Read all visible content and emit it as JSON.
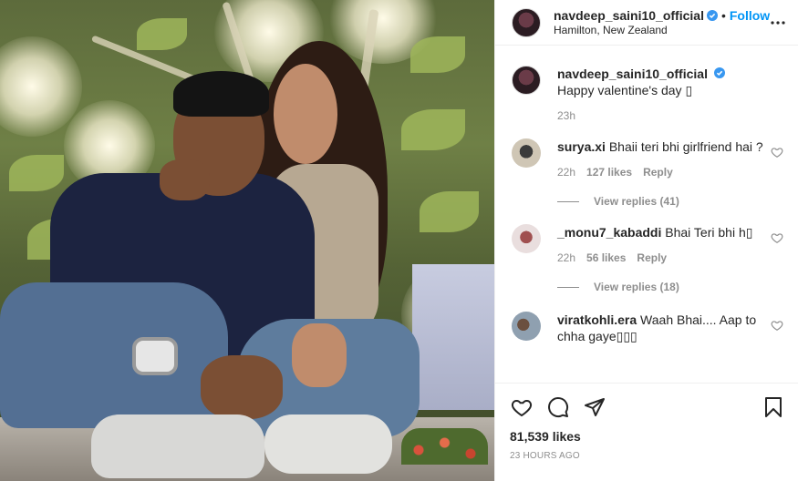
{
  "post": {
    "author": {
      "username": "navdeep_saini10_official",
      "location": "Hamilton, New Zealand",
      "follow_label": "Follow",
      "separator": "•"
    },
    "caption": {
      "username": "navdeep_saini10_official",
      "text": "Happy valentine's day ",
      "time": "23h"
    },
    "comments": [
      {
        "username": "surya.xi",
        "text": "Bhaii teri bhi girlfriend hai ?",
        "time": "22h",
        "likes": "127 likes",
        "reply_label": "Reply",
        "view_replies": "View replies (41)"
      },
      {
        "username": "_monu7_kabaddi",
        "text": "Bhai Teri bhi h",
        "time": "22h",
        "likes": "56 likes",
        "reply_label": "Reply",
        "view_replies": "View replies (18)"
      },
      {
        "username": "viratkohli.era",
        "text": "Waah Bhai.... Aap to chha gaye"
      }
    ],
    "likes_count": "81,539 likes",
    "posted_ago": "23 HOURS AGO"
  },
  "colors": {
    "link_blue": "#0095f6",
    "verified_blue": "#3897f0",
    "meta_gray": "#8e8e8e",
    "text": "#262626"
  },
  "icons": [
    "verified-badge-icon",
    "more-options-icon",
    "heart-icon",
    "comment-icon",
    "share-icon",
    "bookmark-icon"
  ]
}
